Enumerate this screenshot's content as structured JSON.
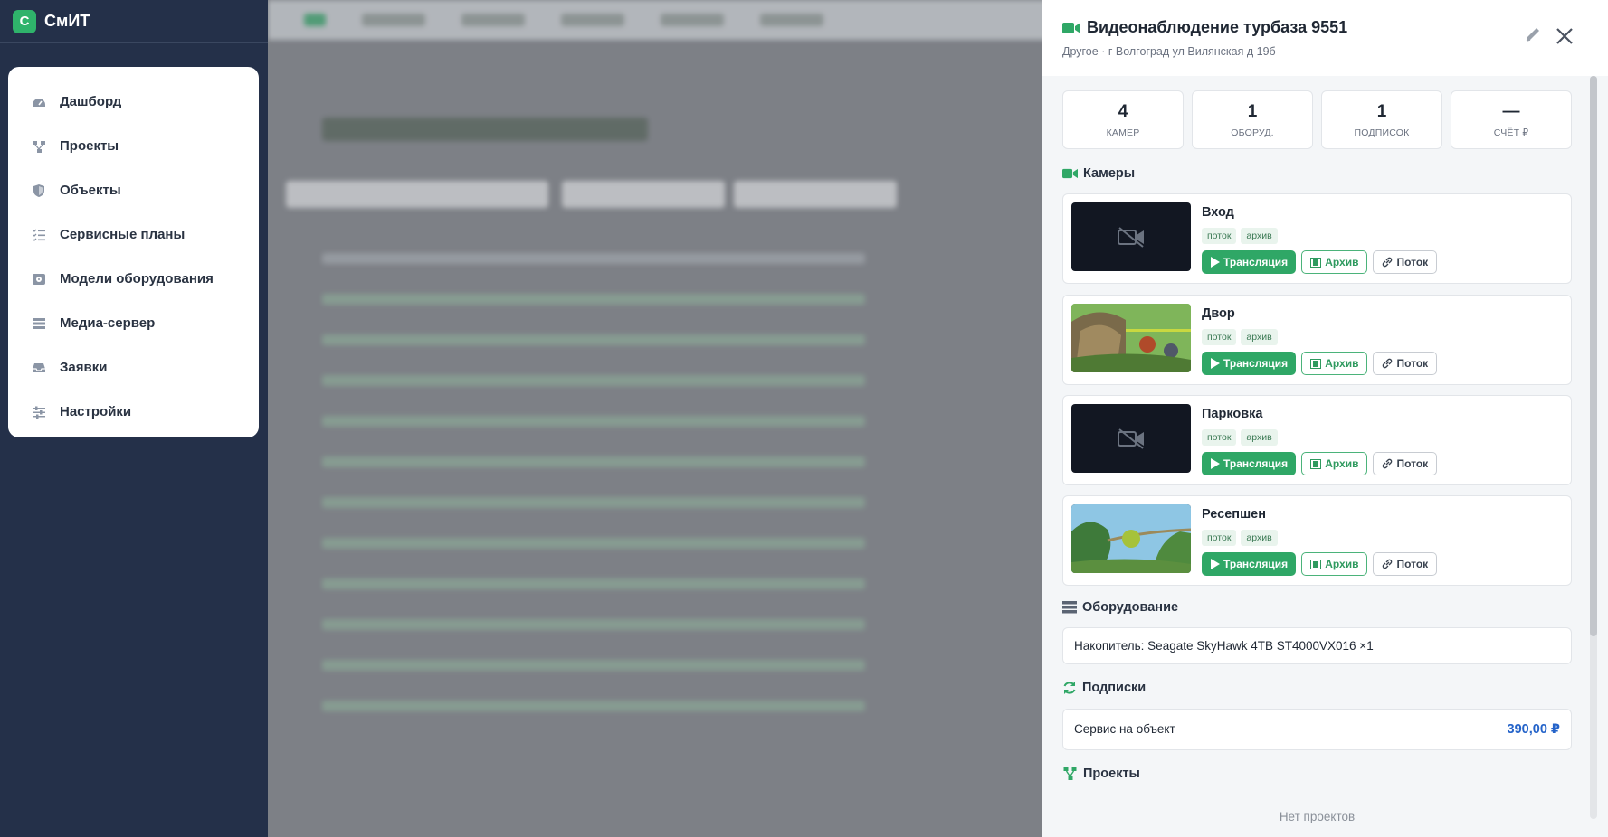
{
  "app": {
    "logo_letter": "С",
    "name": "СмИТ"
  },
  "sidebar": {
    "items": [
      {
        "label": "Дашборд",
        "icon": "gauge-icon"
      },
      {
        "label": "Проекты",
        "icon": "project-tree-icon"
      },
      {
        "label": "Объекты",
        "icon": "shield-icon"
      },
      {
        "label": "Сервисные планы",
        "icon": "list-check-icon"
      },
      {
        "label": "Модели оборудования",
        "icon": "hdd-icon"
      },
      {
        "label": "Медиа-сервер",
        "icon": "server-icon"
      },
      {
        "label": "Заявки",
        "icon": "inbox-icon"
      },
      {
        "label": "Настройки",
        "icon": "sliders-icon"
      }
    ]
  },
  "panel": {
    "title": "Видеонаблюдение турбаза 9551",
    "subtitle": "Другое · г Волгоград ул Вилянская д 19б",
    "stats": [
      {
        "value": "4",
        "label": "КАМЕР"
      },
      {
        "value": "1",
        "label": "ОБОРУД."
      },
      {
        "value": "1",
        "label": "ПОДПИСОК"
      },
      {
        "value": "—",
        "label": "СЧЁТ ₽"
      }
    ],
    "cameras_title": "Камеры",
    "cameras": [
      {
        "name": "Вход",
        "tag1": "поток",
        "tag2": "архив",
        "live": "Трансляция",
        "archive": "Архив",
        "stream": "Поток",
        "has_preview": false
      },
      {
        "name": "Двор",
        "tag1": "поток",
        "tag2": "архив",
        "live": "Трансляция",
        "archive": "Архив",
        "stream": "Поток",
        "has_preview": true
      },
      {
        "name": "Парковка",
        "tag1": "поток",
        "tag2": "архив",
        "live": "Трансляция",
        "archive": "Архив",
        "stream": "Поток",
        "has_preview": false
      },
      {
        "name": "Ресепшен",
        "tag1": "поток",
        "tag2": "архив",
        "live": "Трансляция",
        "archive": "Архив",
        "stream": "Поток",
        "has_preview": true
      }
    ],
    "equipment_title": "Оборудование",
    "equipment": [
      {
        "text": "Накопитель: Seagate SkyHawk 4TB ST4000VX016 ×1"
      }
    ],
    "subscriptions_title": "Подписки",
    "subscriptions": [
      {
        "name": "Сервис на объект",
        "price": "390,00 ₽"
      }
    ],
    "projects_title": "Проекты",
    "projects_empty": "Нет проектов"
  },
  "colors": {
    "accent": "#2fa766",
    "sidebar_bg": "#243049",
    "price": "#2463c9"
  }
}
